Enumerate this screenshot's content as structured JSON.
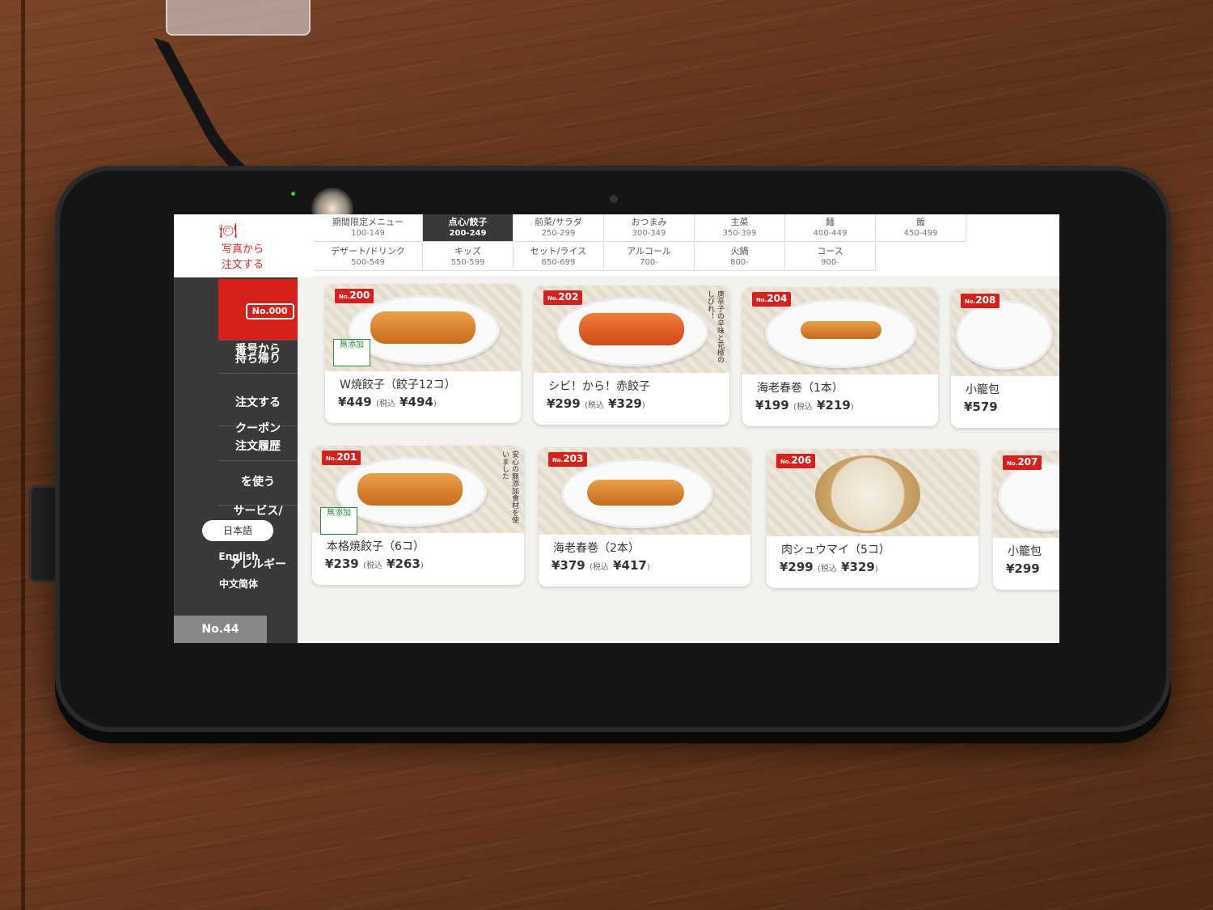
{
  "branding": {
    "line1": "写真から",
    "line2": "注文する"
  },
  "tabs": [
    {
      "label": "期間限定メニュー",
      "range": "100-149"
    },
    {
      "label": "点心/餃子",
      "range": "200-249",
      "active": true
    },
    {
      "label": "前菜/サラダ",
      "range": "250-299"
    },
    {
      "label": "おつまみ",
      "range": "300-349"
    },
    {
      "label": "主菜",
      "range": "350-399"
    },
    {
      "label": "麺",
      "range": "400-449"
    },
    {
      "label": "飯",
      "range": "450-499"
    },
    {
      "label": "デザート/ドリンク",
      "range": "500-549"
    },
    {
      "label": "キッズ",
      "range": "550-599"
    },
    {
      "label": "セット/ライス",
      "range": "650-699"
    },
    {
      "label": "アルコール",
      "range": "700-"
    },
    {
      "label": "火鍋",
      "range": "800-"
    },
    {
      "label": "コース",
      "range": "900-"
    }
  ],
  "sidebar": {
    "number_order": {
      "badge": "No.000",
      "line1": "番号から",
      "line2": "注文する"
    },
    "takeout": "持ち帰り",
    "coupon": {
      "line1": "クーポン",
      "line2": "を使う"
    },
    "history": "注文履歴",
    "service": {
      "line1": "サービス/",
      "line2": "アレルギー"
    },
    "languages": [
      "日本語",
      "English",
      "中文简体"
    ],
    "table_number": "No.44"
  },
  "menu_items": [
    {
      "no": "200",
      "name": "W焼餃子（餃子12コ）",
      "price": "¥449",
      "tax_label": "(税込",
      "tax_price": "¥494",
      "close": ")",
      "badge": "無添加"
    },
    {
      "no": "202",
      "name": "シビ！から！赤餃子",
      "price": "¥299",
      "tax_label": "(税込",
      "tax_price": "¥329",
      "close": ")",
      "note": "唐辛子の辛味と花椒のしびれ！"
    },
    {
      "no": "204",
      "name": "海老春巻（1本）",
      "price": "¥199",
      "tax_label": "(税込",
      "tax_price": "¥219",
      "close": ")"
    },
    {
      "no": "208",
      "name": "小籠包",
      "price": "¥579"
    },
    {
      "no": "201",
      "name": "本格焼餃子（6コ）",
      "price": "¥239",
      "tax_label": "(税込",
      "tax_price": "¥263",
      "close": ")",
      "badge": "無添加",
      "note": "安心の無添加食材を使いました"
    },
    {
      "no": "203",
      "name": "海老春巻（2本）",
      "price": "¥379",
      "tax_label": "(税込",
      "tax_price": "¥417",
      "close": ")"
    },
    {
      "no": "206",
      "name": "肉シュウマイ（5コ）",
      "price": "¥299",
      "tax_label": "(税込",
      "tax_price": "¥329",
      "close": ")"
    },
    {
      "no": "207",
      "name": "小籠包",
      "price": "¥299"
    }
  ],
  "colors": {
    "accent_red": "#d6201b",
    "sidebar_dark": "#3b3937",
    "screen_bg": "#f4f2ee"
  }
}
